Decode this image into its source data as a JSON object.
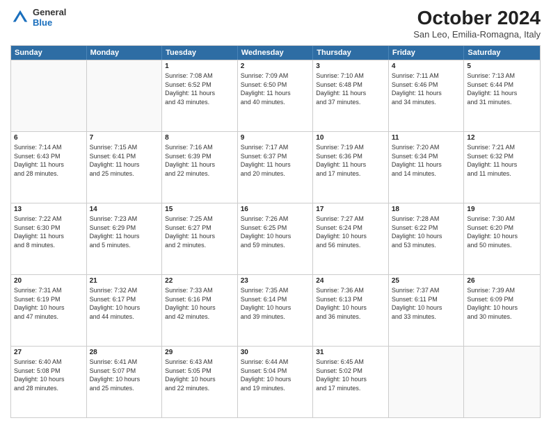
{
  "header": {
    "logo_general": "General",
    "logo_blue": "Blue",
    "month_title": "October 2024",
    "location": "San Leo, Emilia-Romagna, Italy"
  },
  "weekdays": [
    "Sunday",
    "Monday",
    "Tuesday",
    "Wednesday",
    "Thursday",
    "Friday",
    "Saturday"
  ],
  "rows": [
    [
      {
        "day": "",
        "lines": [],
        "empty": true
      },
      {
        "day": "",
        "lines": [],
        "empty": true
      },
      {
        "day": "1",
        "lines": [
          "Sunrise: 7:08 AM",
          "Sunset: 6:52 PM",
          "Daylight: 11 hours",
          "and 43 minutes."
        ],
        "empty": false
      },
      {
        "day": "2",
        "lines": [
          "Sunrise: 7:09 AM",
          "Sunset: 6:50 PM",
          "Daylight: 11 hours",
          "and 40 minutes."
        ],
        "empty": false
      },
      {
        "day": "3",
        "lines": [
          "Sunrise: 7:10 AM",
          "Sunset: 6:48 PM",
          "Daylight: 11 hours",
          "and 37 minutes."
        ],
        "empty": false
      },
      {
        "day": "4",
        "lines": [
          "Sunrise: 7:11 AM",
          "Sunset: 6:46 PM",
          "Daylight: 11 hours",
          "and 34 minutes."
        ],
        "empty": false
      },
      {
        "day": "5",
        "lines": [
          "Sunrise: 7:13 AM",
          "Sunset: 6:44 PM",
          "Daylight: 11 hours",
          "and 31 minutes."
        ],
        "empty": false
      }
    ],
    [
      {
        "day": "6",
        "lines": [
          "Sunrise: 7:14 AM",
          "Sunset: 6:43 PM",
          "Daylight: 11 hours",
          "and 28 minutes."
        ],
        "empty": false
      },
      {
        "day": "7",
        "lines": [
          "Sunrise: 7:15 AM",
          "Sunset: 6:41 PM",
          "Daylight: 11 hours",
          "and 25 minutes."
        ],
        "empty": false
      },
      {
        "day": "8",
        "lines": [
          "Sunrise: 7:16 AM",
          "Sunset: 6:39 PM",
          "Daylight: 11 hours",
          "and 22 minutes."
        ],
        "empty": false
      },
      {
        "day": "9",
        "lines": [
          "Sunrise: 7:17 AM",
          "Sunset: 6:37 PM",
          "Daylight: 11 hours",
          "and 20 minutes."
        ],
        "empty": false
      },
      {
        "day": "10",
        "lines": [
          "Sunrise: 7:19 AM",
          "Sunset: 6:36 PM",
          "Daylight: 11 hours",
          "and 17 minutes."
        ],
        "empty": false
      },
      {
        "day": "11",
        "lines": [
          "Sunrise: 7:20 AM",
          "Sunset: 6:34 PM",
          "Daylight: 11 hours",
          "and 14 minutes."
        ],
        "empty": false
      },
      {
        "day": "12",
        "lines": [
          "Sunrise: 7:21 AM",
          "Sunset: 6:32 PM",
          "Daylight: 11 hours",
          "and 11 minutes."
        ],
        "empty": false
      }
    ],
    [
      {
        "day": "13",
        "lines": [
          "Sunrise: 7:22 AM",
          "Sunset: 6:30 PM",
          "Daylight: 11 hours",
          "and 8 minutes."
        ],
        "empty": false
      },
      {
        "day": "14",
        "lines": [
          "Sunrise: 7:23 AM",
          "Sunset: 6:29 PM",
          "Daylight: 11 hours",
          "and 5 minutes."
        ],
        "empty": false
      },
      {
        "day": "15",
        "lines": [
          "Sunrise: 7:25 AM",
          "Sunset: 6:27 PM",
          "Daylight: 11 hours",
          "and 2 minutes."
        ],
        "empty": false
      },
      {
        "day": "16",
        "lines": [
          "Sunrise: 7:26 AM",
          "Sunset: 6:25 PM",
          "Daylight: 10 hours",
          "and 59 minutes."
        ],
        "empty": false
      },
      {
        "day": "17",
        "lines": [
          "Sunrise: 7:27 AM",
          "Sunset: 6:24 PM",
          "Daylight: 10 hours",
          "and 56 minutes."
        ],
        "empty": false
      },
      {
        "day": "18",
        "lines": [
          "Sunrise: 7:28 AM",
          "Sunset: 6:22 PM",
          "Daylight: 10 hours",
          "and 53 minutes."
        ],
        "empty": false
      },
      {
        "day": "19",
        "lines": [
          "Sunrise: 7:30 AM",
          "Sunset: 6:20 PM",
          "Daylight: 10 hours",
          "and 50 minutes."
        ],
        "empty": false
      }
    ],
    [
      {
        "day": "20",
        "lines": [
          "Sunrise: 7:31 AM",
          "Sunset: 6:19 PM",
          "Daylight: 10 hours",
          "and 47 minutes."
        ],
        "empty": false
      },
      {
        "day": "21",
        "lines": [
          "Sunrise: 7:32 AM",
          "Sunset: 6:17 PM",
          "Daylight: 10 hours",
          "and 44 minutes."
        ],
        "empty": false
      },
      {
        "day": "22",
        "lines": [
          "Sunrise: 7:33 AM",
          "Sunset: 6:16 PM",
          "Daylight: 10 hours",
          "and 42 minutes."
        ],
        "empty": false
      },
      {
        "day": "23",
        "lines": [
          "Sunrise: 7:35 AM",
          "Sunset: 6:14 PM",
          "Daylight: 10 hours",
          "and 39 minutes."
        ],
        "empty": false
      },
      {
        "day": "24",
        "lines": [
          "Sunrise: 7:36 AM",
          "Sunset: 6:13 PM",
          "Daylight: 10 hours",
          "and 36 minutes."
        ],
        "empty": false
      },
      {
        "day": "25",
        "lines": [
          "Sunrise: 7:37 AM",
          "Sunset: 6:11 PM",
          "Daylight: 10 hours",
          "and 33 minutes."
        ],
        "empty": false
      },
      {
        "day": "26",
        "lines": [
          "Sunrise: 7:39 AM",
          "Sunset: 6:09 PM",
          "Daylight: 10 hours",
          "and 30 minutes."
        ],
        "empty": false
      }
    ],
    [
      {
        "day": "27",
        "lines": [
          "Sunrise: 6:40 AM",
          "Sunset: 5:08 PM",
          "Daylight: 10 hours",
          "and 28 minutes."
        ],
        "empty": false
      },
      {
        "day": "28",
        "lines": [
          "Sunrise: 6:41 AM",
          "Sunset: 5:07 PM",
          "Daylight: 10 hours",
          "and 25 minutes."
        ],
        "empty": false
      },
      {
        "day": "29",
        "lines": [
          "Sunrise: 6:43 AM",
          "Sunset: 5:05 PM",
          "Daylight: 10 hours",
          "and 22 minutes."
        ],
        "empty": false
      },
      {
        "day": "30",
        "lines": [
          "Sunrise: 6:44 AM",
          "Sunset: 5:04 PM",
          "Daylight: 10 hours",
          "and 19 minutes."
        ],
        "empty": false
      },
      {
        "day": "31",
        "lines": [
          "Sunrise: 6:45 AM",
          "Sunset: 5:02 PM",
          "Daylight: 10 hours",
          "and 17 minutes."
        ],
        "empty": false
      },
      {
        "day": "",
        "lines": [],
        "empty": true
      },
      {
        "day": "",
        "lines": [],
        "empty": true
      }
    ]
  ]
}
